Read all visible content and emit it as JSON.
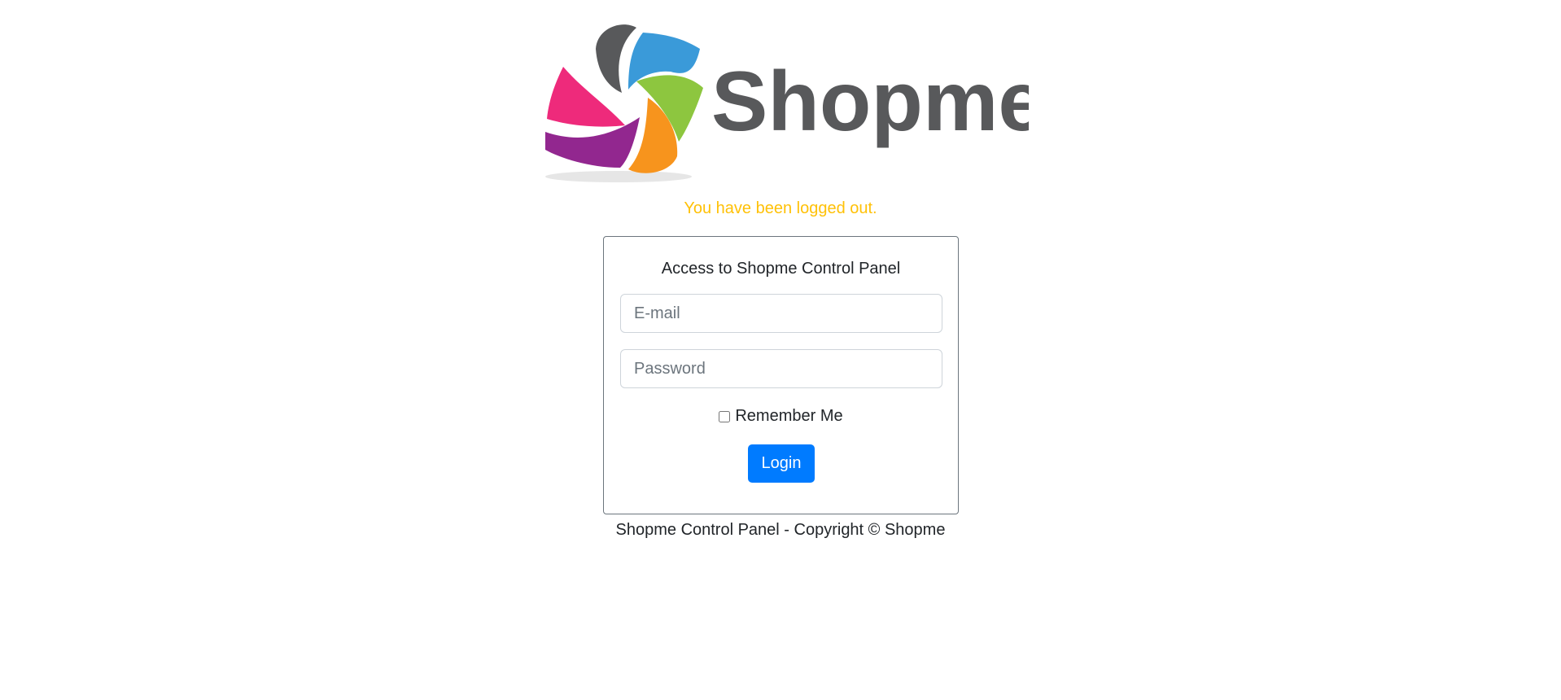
{
  "logo": {
    "text": "Shopme",
    "colors": {
      "text": "#58595b",
      "dark_petal": "#58595b",
      "blue_petal": "#3a9ad9",
      "green_petal": "#8dc63f",
      "orange_petal": "#f7941d",
      "purple_petal": "#92278f",
      "pink_petal": "#ee2a7b"
    }
  },
  "message": {
    "logout_text": "You have been logged out.",
    "color": "#ffc107"
  },
  "login_panel": {
    "title": "Access to Shopme Control Panel",
    "email": {
      "value": "",
      "placeholder": "E-mail"
    },
    "password": {
      "value": "",
      "placeholder": "Password"
    },
    "remember_me": {
      "label": "Remember Me",
      "checked": false
    },
    "login_button_label": "Login",
    "button_color": "#007bff"
  },
  "footer": {
    "text": "Shopme Control Panel - Copyright © Shopme"
  }
}
